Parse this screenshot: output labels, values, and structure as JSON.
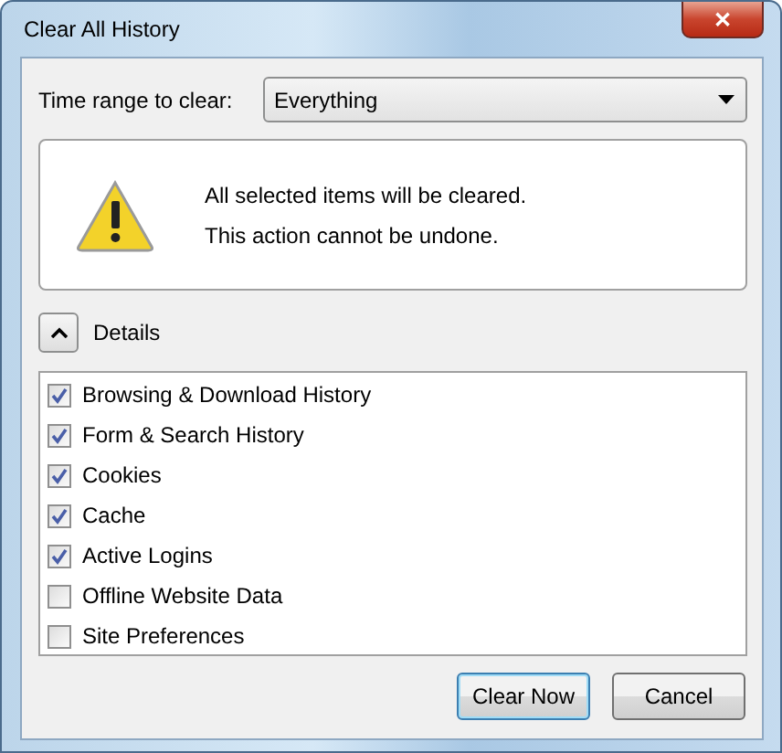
{
  "window": {
    "title": "Clear All History",
    "close_symbol": "✕"
  },
  "time_range": {
    "label": "Time range to clear:",
    "value": "Everything"
  },
  "warning": {
    "lines": [
      "All selected items will be cleared.",
      "This action cannot be undone."
    ]
  },
  "details": {
    "label": "Details",
    "expanded": true
  },
  "items": [
    {
      "label": "Browsing & Download History",
      "checked": true
    },
    {
      "label": "Form & Search History",
      "checked": true
    },
    {
      "label": "Cookies",
      "checked": true
    },
    {
      "label": "Cache",
      "checked": true
    },
    {
      "label": "Active Logins",
      "checked": true
    },
    {
      "label": "Offline Website Data",
      "checked": false
    },
    {
      "label": "Site Preferences",
      "checked": false
    }
  ],
  "buttons": [
    {
      "label": "Clear Now",
      "default": true
    },
    {
      "label": "Cancel",
      "default": false
    }
  ]
}
